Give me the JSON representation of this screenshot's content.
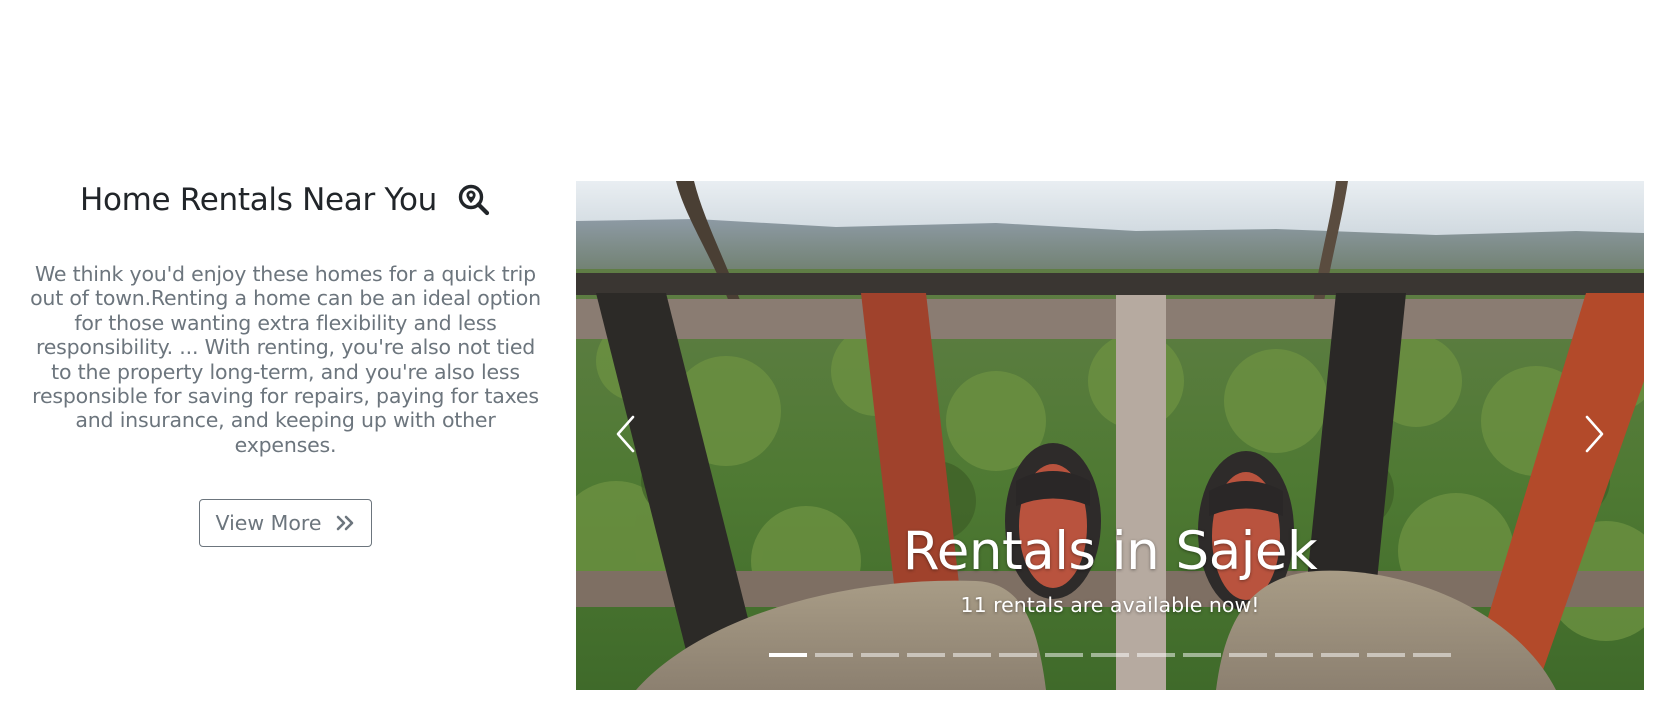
{
  "intro": {
    "title": "Home Rentals Near You",
    "title_icon": "search-location-icon",
    "text": "We think you'd enjoy these homes for a quick trip out of town.Renting a home can be an ideal option for those wanting extra flexibility and less responsibility. ... With renting, you're also not tied to the property long-term, and you're also less responsible for saving for repairs, paying for taxes and insurance, and keeping up with other expenses.",
    "button_label": "View More",
    "button_icon": "double-chevron-right-icon"
  },
  "carousel": {
    "slide_title": "Rentals in Sajek",
    "slide_subtitle": "11 rentals are available now!",
    "slide_count": 15,
    "active_index": 0,
    "prev_icon": "chevron-left-icon",
    "next_icon": "chevron-right-icon"
  },
  "colors": {
    "text_dark": "#212529",
    "text_muted": "#6c757d",
    "button_border": "#6c757d"
  }
}
